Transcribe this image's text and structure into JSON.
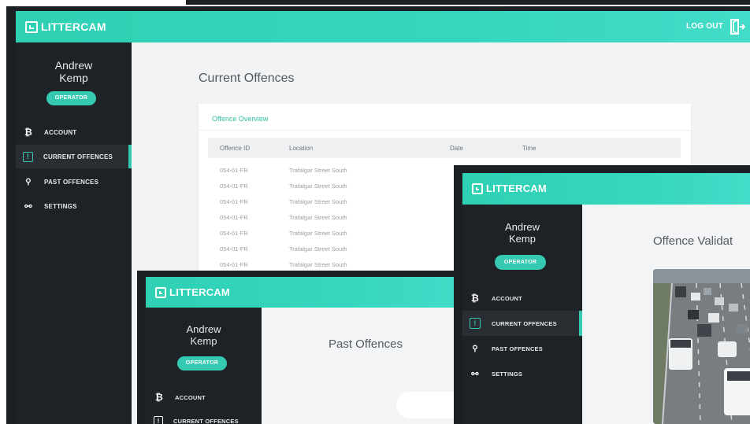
{
  "brand": {
    "name": "LITTERCAM",
    "accent": "#34c9b0",
    "dark": "#1e2226"
  },
  "header": {
    "logout_label": "LOG OUT",
    "logout_icon": "logout-door-icon"
  },
  "user": {
    "first_name": "Andrew",
    "last_name": "Kemp",
    "role": "OPERATOR"
  },
  "nav": {
    "account": "ACCOUNT",
    "current_offences": "CURRENT OFFENCES",
    "past_offences": "PAST OFFENCES",
    "settings": "SETTINGS"
  },
  "current": {
    "title": "Current Offences",
    "card_title": "Offence Overview",
    "columns": [
      "Offence ID",
      "Location",
      "Date",
      "Time"
    ],
    "rows": [
      [
        "054-01-FR",
        "Trafalgar Street South"
      ],
      [
        "054-01-FR",
        "Trafalgar Street South"
      ],
      [
        "054-01-FR",
        "Trafalgar Street South"
      ],
      [
        "054-01-FR",
        "Trafalgar Street South"
      ],
      [
        "054-01-FR",
        "Trafalgar Street South"
      ],
      [
        "054-01-FR",
        "Trafalgar Street South"
      ],
      [
        "054-01-FR",
        "Trafalgar Street South"
      ]
    ]
  },
  "past": {
    "title": "Past Offences"
  },
  "validation": {
    "title": "Offence Validat"
  }
}
